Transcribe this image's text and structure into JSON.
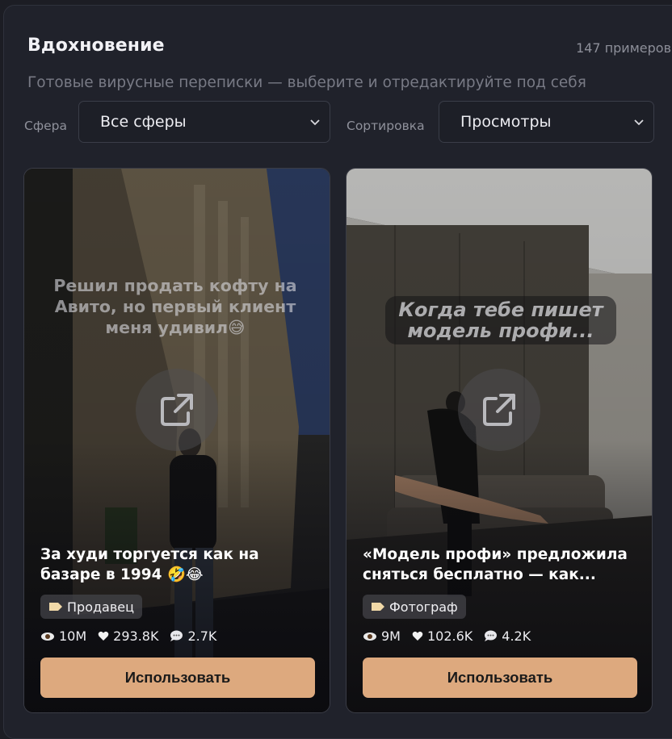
{
  "header": {
    "title": "Вдохновение",
    "count": "147 примеров",
    "subtitle": "Готовые вирусные переписки — выберите и отредактируйте под себя"
  },
  "filters": {
    "sphere_label": "Сфера",
    "sphere_value": "Все сферы",
    "sort_label": "Сортировка",
    "sort_value": "Просмотры"
  },
  "cards": [
    {
      "overlay": "Решил продать кофту на Авито, но первый клиент меня удивил😅",
      "title": "За худи торгуется как на базаре в 1994 🤣😂",
      "tag": "Продавец",
      "views": "10M",
      "likes": "293.8K",
      "comments": "2.7K",
      "button": "Использовать"
    },
    {
      "overlay": "Когда тебе пишет модель профи...",
      "title": "«Модель профи» предложила сняться бесплатно — как...",
      "tag": "Фотограф",
      "views": "9M",
      "likes": "102.6K",
      "comments": "4.2K",
      "button": "Использовать"
    }
  ],
  "icons": {
    "views": "eye-icon",
    "likes": "heart-icon",
    "comments": "speech-bubble-icon",
    "tag": "label-icon",
    "open": "external-link-icon",
    "dropdown": "chevron-down-icon"
  },
  "colors": {
    "accent_button": "#dda97e",
    "panel": "#20222b"
  }
}
